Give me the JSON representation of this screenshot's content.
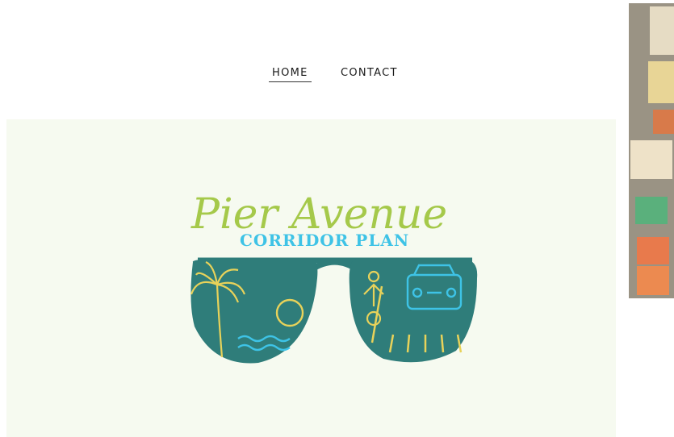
{
  "nav": {
    "items": [
      {
        "label": "HOME",
        "active": true
      },
      {
        "label": "CONTACT",
        "active": false
      }
    ]
  },
  "logo": {
    "title": "Pier Avenue",
    "subtitle": "CORRIDOR PLAN",
    "colors": {
      "title": "#a5c94a",
      "subtitle": "#3ec3e6",
      "lens": "#2f7d7a",
      "line_art": "#e8d25a",
      "water": "#3ec3e6",
      "car": "#3ec3e6"
    }
  },
  "hero": {
    "background": "#f6faf0"
  },
  "side_photo": {
    "description_icon": "sticky-notes-photo"
  }
}
